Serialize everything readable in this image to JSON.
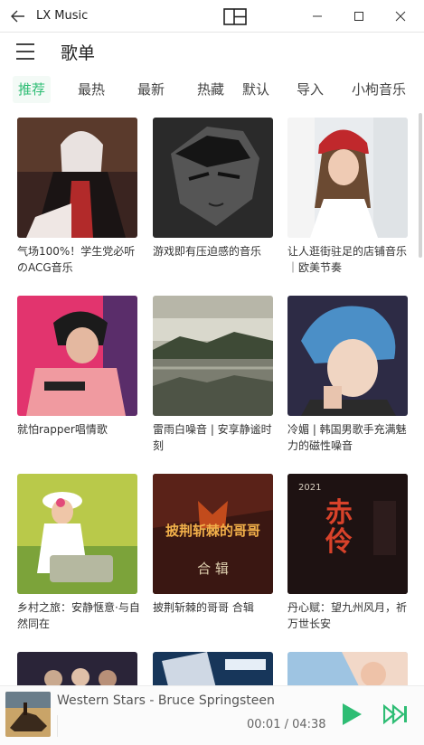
{
  "window": {
    "title": "LX Music"
  },
  "header": {
    "title": "歌单"
  },
  "tabs": [
    {
      "label": "推荐",
      "active": true
    },
    {
      "label": "最热"
    },
    {
      "label": "最新"
    },
    {
      "label": "热藏"
    },
    {
      "label": "默认"
    },
    {
      "label": "导入"
    },
    {
      "label": "小枸音乐"
    }
  ],
  "playlists": [
    {
      "title": "气场100%！学生党必听のACG音乐"
    },
    {
      "title": "游戏即有压迫感的音乐"
    },
    {
      "title": "让人逛街驻足的店铺音乐｜欧美节奏"
    },
    {
      "title": "就怕rapper唱情歌"
    },
    {
      "title": "雷雨白噪音 | 安享静谧时刻"
    },
    {
      "title": "冷媚 | 韩国男歌手充满魅力的磁性噪音"
    },
    {
      "title": "乡村之旅：安静惬意·与自然同在"
    },
    {
      "title": "披荆斩棘的哥哥 合辑",
      "cover_text": [
        "披荆斩棘的哥哥",
        "合 辑"
      ]
    },
    {
      "title": "丹心赋：望九州风月，祈万世长安",
      "cover_text": [
        "赤伶",
        "2021"
      ]
    },
    {
      "title": ""
    },
    {
      "title": ""
    },
    {
      "title": ""
    }
  ],
  "player": {
    "track": "Western Stars - Bruce Springsteen",
    "time": "00:01 / 04:38"
  },
  "colors": {
    "accent": "#2ebd74"
  }
}
